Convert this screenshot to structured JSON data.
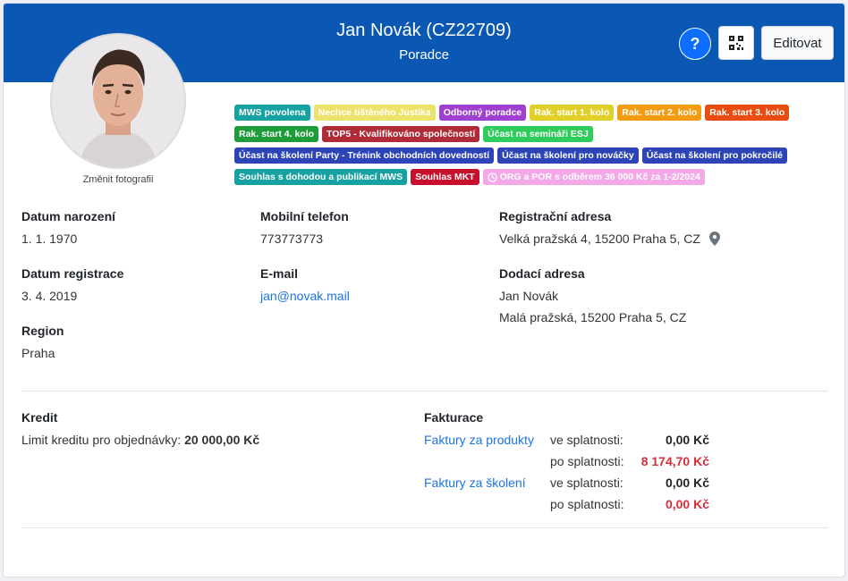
{
  "header": {
    "name": "Jan Novák (CZ22709)",
    "role": "Poradce",
    "help_label": "?",
    "edit_label": "Editovat"
  },
  "profile": {
    "change_photo": "Změnit fotografii"
  },
  "badges": [
    {
      "text": "MWS povolena",
      "color": "#17a2a2"
    },
    {
      "text": "Nechce tištěného Justika",
      "color": "#eee36a"
    },
    {
      "text": "Odborný poradce",
      "color": "#a040d0"
    },
    {
      "text": "Rak. start 1. kolo",
      "color": "#e2d02a"
    },
    {
      "text": "Rak. start 2. kolo",
      "color": "#f39c12"
    },
    {
      "text": "Rak. start 3. kolo",
      "color": "#ea4b0f"
    },
    {
      "text": "Rak. start 4. kolo",
      "color": "#1e9c3a"
    },
    {
      "text": "TOP5 - Kvalifikováno společností",
      "color": "#b02a37"
    },
    {
      "text": "Účast na semináři ESJ",
      "color": "#2ecc5a"
    },
    {
      "text": "Účast na školení Party - Trénink obchodních dovedností",
      "color": "#2d44b8"
    },
    {
      "text": "Účast na školení pro nováčky",
      "color": "#2d44b8"
    },
    {
      "text": "Účast na školení pro pokročilé",
      "color": "#2d44b8"
    },
    {
      "text": "Souhlas s dohodou a publikací MWS",
      "color": "#17a2a2"
    },
    {
      "text": "Souhlas MKT",
      "color": "#c8102e"
    },
    {
      "text": "ORG a POR s odběrem 36 000 Kč za 1-2/2024",
      "color": "#f5a8e8",
      "icon": "clock-icon"
    }
  ],
  "info": {
    "birth_label": "Datum narození",
    "birth_value": "1. 1. 1970",
    "reg_label": "Datum registrace",
    "reg_value": "3. 4. 2019",
    "region_label": "Region",
    "region_value": "Praha",
    "phone_label": "Mobilní telefon",
    "phone_value": "773773773",
    "email_label": "E-mail",
    "email_value": "jan@novak.mail",
    "reg_addr_label": "Registrační adresa",
    "reg_addr_value": "Velká pražská 4, 15200 Praha 5, CZ",
    "delivery_label": "Dodací adresa",
    "delivery_name": "Jan Novák",
    "delivery_addr": "Malá pražská, 15200 Praha 5, CZ"
  },
  "credit": {
    "title": "Kredit",
    "limit_label": "Limit kreditu pro objednávky:",
    "limit_value": "20 000,00 Kč"
  },
  "billing": {
    "title": "Fakturace",
    "products_link": "Faktury za produkty",
    "training_link": "Faktury za školení",
    "due_label": "ve splatnosti:",
    "overdue_label": "po splatnosti:",
    "products_due": "0,00 Kč",
    "products_overdue": "8 174,70 Kč",
    "training_due": "0,00 Kč",
    "training_overdue": "0,00 Kč"
  }
}
